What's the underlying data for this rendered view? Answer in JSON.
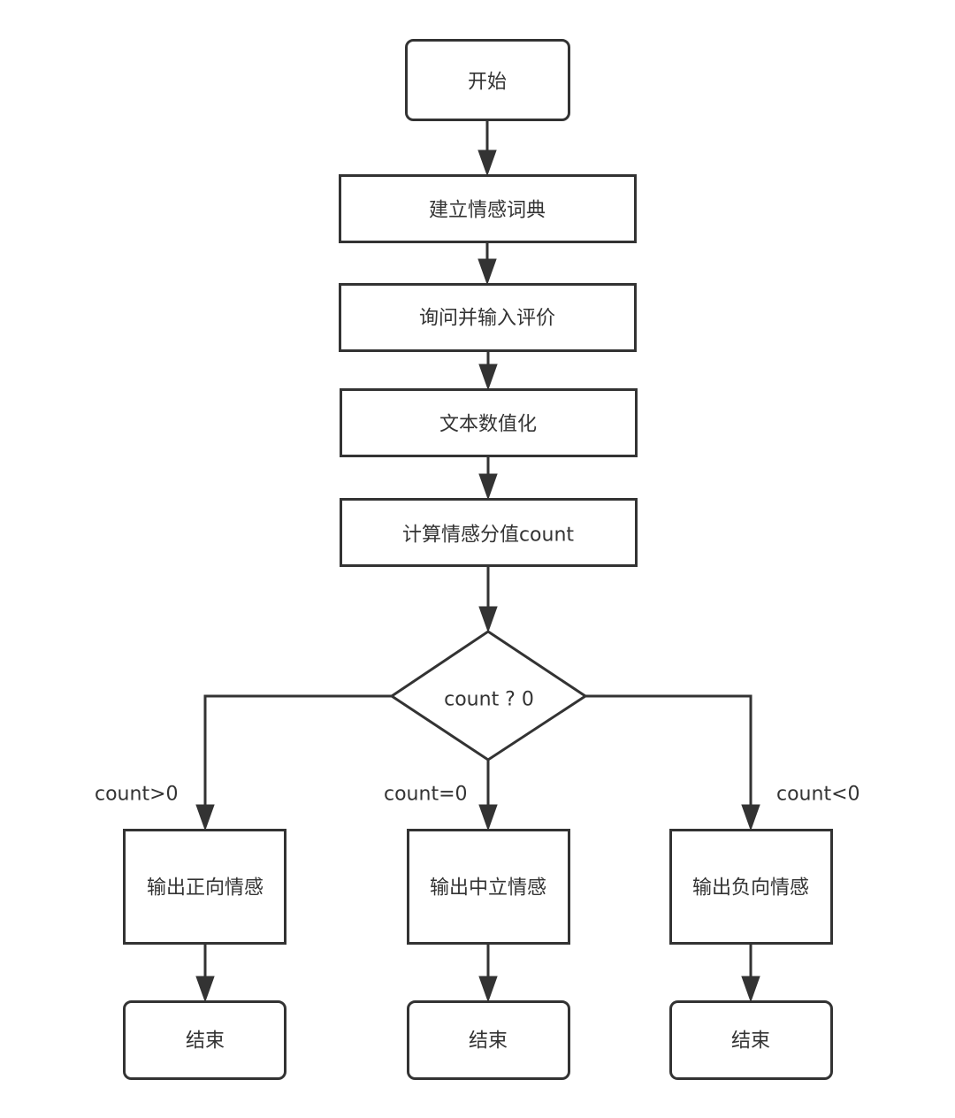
{
  "diagram": {
    "type": "flowchart",
    "colors": {
      "stroke": "#333333",
      "fill": "#ffffff",
      "text": "#333333",
      "background": "#ffffff"
    },
    "nodes": {
      "start": {
        "label": "开始",
        "shape": "rounded-rect"
      },
      "build_dict": {
        "label": "建立情感词典",
        "shape": "rect"
      },
      "input_review": {
        "label": "询问并输入评价",
        "shape": "rect"
      },
      "vectorize": {
        "label": "文本数值化",
        "shape": "rect"
      },
      "compute": {
        "label": "计算情感分值count",
        "shape": "rect"
      },
      "decision": {
        "label": "count ? 0",
        "shape": "diamond"
      },
      "positive": {
        "label": "输出正向情感",
        "shape": "rect"
      },
      "neutral": {
        "label": "输出中立情感",
        "shape": "rect"
      },
      "negative": {
        "label": "输出负向情感",
        "shape": "rect"
      },
      "end_left": {
        "label": "结束",
        "shape": "rounded-rect"
      },
      "end_middle": {
        "label": "结束",
        "shape": "rounded-rect"
      },
      "end_right": {
        "label": "结束",
        "shape": "rounded-rect"
      }
    },
    "edges": [
      {
        "from": "start",
        "to": "build_dict",
        "label": ""
      },
      {
        "from": "build_dict",
        "to": "input_review",
        "label": ""
      },
      {
        "from": "input_review",
        "to": "vectorize",
        "label": ""
      },
      {
        "from": "vectorize",
        "to": "compute",
        "label": ""
      },
      {
        "from": "compute",
        "to": "decision",
        "label": ""
      },
      {
        "from": "decision",
        "to": "positive",
        "label": "count>0"
      },
      {
        "from": "decision",
        "to": "neutral",
        "label": "count=0"
      },
      {
        "from": "decision",
        "to": "negative",
        "label": "count<0"
      },
      {
        "from": "positive",
        "to": "end_left",
        "label": ""
      },
      {
        "from": "neutral",
        "to": "end_middle",
        "label": ""
      },
      {
        "from": "negative",
        "to": "end_right",
        "label": ""
      }
    ]
  }
}
